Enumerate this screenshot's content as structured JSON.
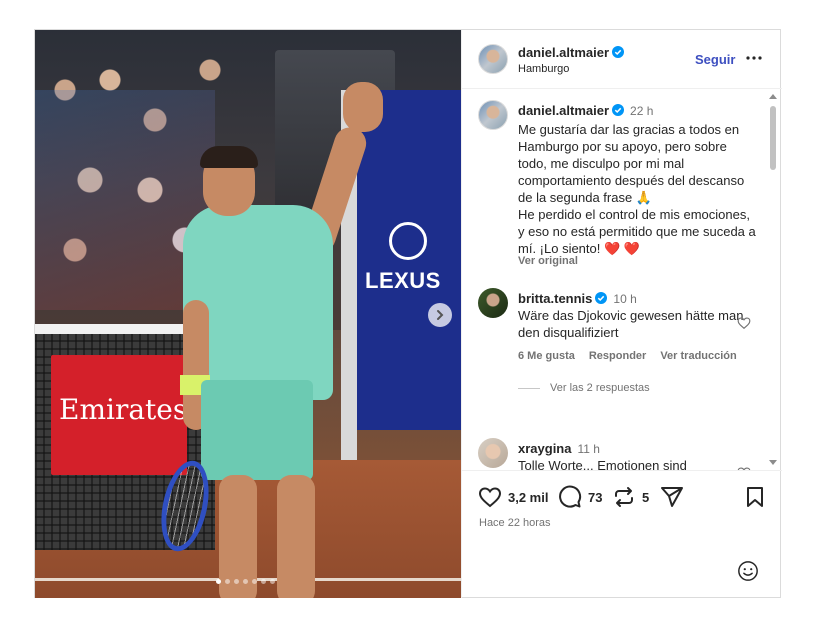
{
  "post": {
    "author": {
      "username": "daniel.altmaier",
      "location": "Hamburgo",
      "verified": true
    },
    "follow_label": "Seguir",
    "media": {
      "slide_count": 7,
      "active_slide": 1,
      "banner_left": "Emirates",
      "banner_right": "LEXUS"
    },
    "caption": {
      "username": "daniel.altmaier",
      "time": "22 h",
      "line1": "Me gustaría dar las gracias a todos en Hamburgo por su apoyo, pero sobre todo, me disculpo por mi mal comportamiento después del descanso de la segunda frase 🙏",
      "line2": "He perdido el control de mis emociones, y eso no está permitido que me suceda a mí. ¡Lo siento! ❤️ ❤️",
      "see_original": "Ver original"
    },
    "comments": [
      {
        "username": "britta.tennis",
        "verified": true,
        "time": "10 h",
        "text": "Wäre das Djokovic gewesen hätte man den disqualifiziert",
        "likes": "6 Me gusta",
        "reply": "Responder",
        "translate": "Ver traducción",
        "replies": "Ver las 2 respuestas"
      },
      {
        "username": "xraygina",
        "verified": false,
        "time": "11 h",
        "text": "Tolle Worte... Emotionen sind menschlich! Vor allem unter dem Druck! Alles gut, niemand verletzt"
      }
    ],
    "stats": {
      "likes": "3,2 mil",
      "comments": "73",
      "reposts": "5"
    },
    "posted_ago": "Hace 22 horas"
  },
  "colors": {
    "link_blue": "#3d4fc0",
    "verified_blue": "#0095f6",
    "muted": "#737373"
  },
  "icons": [
    "more-icon",
    "verified-icon",
    "heart-icon",
    "comment-icon",
    "repost-icon",
    "share-icon",
    "bookmark-icon",
    "emoji-icon",
    "chevron-right-icon"
  ]
}
